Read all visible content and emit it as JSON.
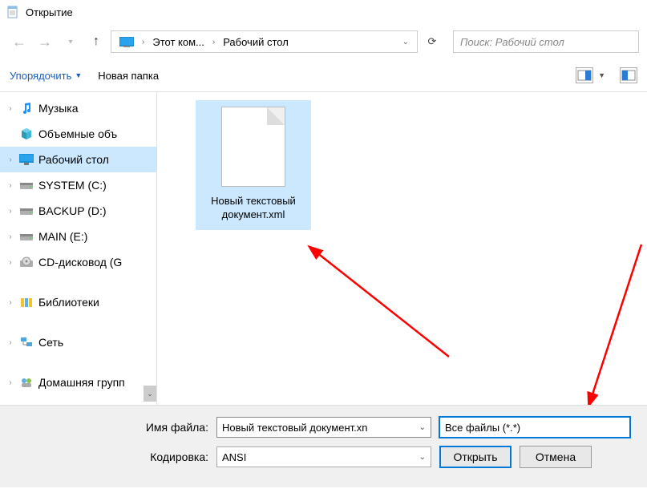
{
  "window": {
    "title": "Открытие"
  },
  "nav": {
    "breadcrumb": [
      {
        "label": "Этот ком..."
      },
      {
        "label": "Рабочий стол"
      }
    ]
  },
  "search": {
    "placeholder": "Поиск: Рабочий стол"
  },
  "toolbar": {
    "organize": "Упорядочить",
    "newfolder": "Новая папка"
  },
  "tree": {
    "items": [
      {
        "label": "Музыка",
        "icon": "music",
        "indent": 1
      },
      {
        "label": "Объемные объ",
        "icon": "cube",
        "indent": 1
      },
      {
        "label": "Рабочий стол",
        "icon": "desktop",
        "indent": 1,
        "selected": true
      },
      {
        "label": "SYSTEM (C:)",
        "icon": "drive",
        "indent": 1
      },
      {
        "label": "BACKUP (D:)",
        "icon": "drive",
        "indent": 1
      },
      {
        "label": "MAIN (E:)",
        "icon": "drive",
        "indent": 1
      },
      {
        "label": "CD-дисковод (G",
        "icon": "cd",
        "indent": 1
      },
      {
        "label": "Библиотеки",
        "icon": "libraries",
        "indent": 0,
        "expandable": true
      },
      {
        "label": "Сеть",
        "icon": "network",
        "indent": 0,
        "expandable": true
      },
      {
        "label": "Домашняя групп",
        "icon": "homegroup",
        "indent": 0,
        "expandable": true
      }
    ]
  },
  "file": {
    "name": "Новый текстовый документ.xml"
  },
  "footer": {
    "filename_label": "Имя файла:",
    "filename_value": "Новый текстовый документ.xn",
    "encoding_label": "Кодировка:",
    "encoding_value": "ANSI",
    "filetype_value": "Все файлы  (*.*)",
    "open": "Открыть",
    "cancel": "Отмена"
  }
}
